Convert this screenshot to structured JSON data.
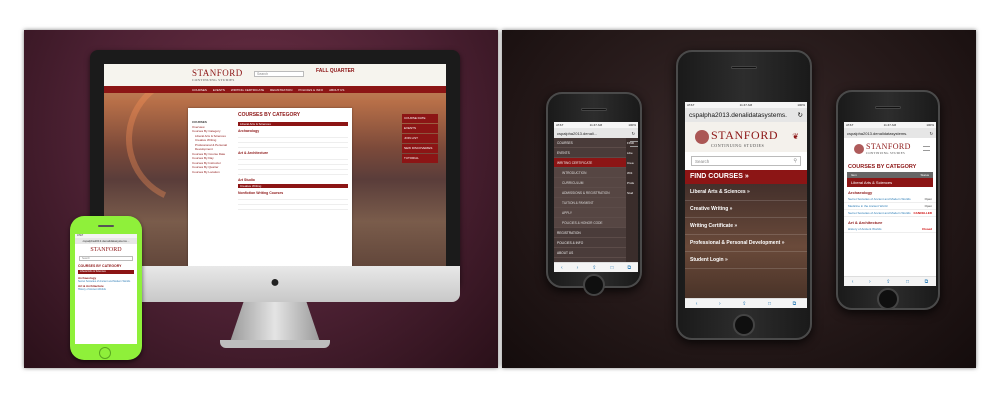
{
  "desktop": {
    "logo": "STANFORD",
    "logo_sub": "CONTINUING STUDIES",
    "search_placeholder": "Search",
    "quarter": "FALL QUARTER",
    "nav": [
      "COURSES",
      "EVENTS",
      "WRITING CERTIFICATE",
      "REGISTRATION",
      "POLICIES & INFO",
      "ABOUT US"
    ],
    "page_title": "COURSES BY CATEGORY",
    "side_title": "COURSES",
    "side_items": [
      "Overview",
      "Courses By Category",
      "Liberal Arts & Sciences",
      "Creative Writing",
      "Professional & Personal Development",
      "Courses By Course Date",
      "Courses By Day",
      "Courses By Instructor",
      "Courses By Quarter",
      "Courses By Location"
    ],
    "bars": [
      "Liberal Arts & Sciences",
      "Creative Writing"
    ],
    "subheads": [
      "Archaeology",
      "Art & Architecture",
      "Art Studio",
      "Nonfiction Writing Courses"
    ],
    "side_buttons": [
      "COURSE DATE",
      "EVENTS",
      "JOIN LIST",
      "NEW DISCOVERIES",
      "TUTORIAL"
    ]
  },
  "green_phone": {
    "status": "AT&T",
    "url": "cspalpha2013.denalidatasystems...",
    "logo": "STANFORD",
    "search_placeholder": "Search",
    "heading": "COURSES BY CATEGORY",
    "red_bar": "Liberal Arts & Sciences",
    "sub1": "Archaeology",
    "line1": "Secret Societies of Ancient and Modern Worlds",
    "sub2": "Art & Architecture",
    "line2": "History of Ancient Worlds"
  },
  "phone_a": {
    "status_left": "AT&T",
    "status_time": "11:47 AM",
    "status_right": "100%",
    "url": "cspalpha2013.denali...",
    "menu": [
      {
        "label": "COURSES",
        "type": "top"
      },
      {
        "label": "EVENTS",
        "type": "top"
      },
      {
        "label": "WRITING CERTIFICATE",
        "type": "active"
      },
      {
        "label": "INTRODUCTION",
        "type": "sub"
      },
      {
        "label": "CURRICULUM",
        "type": "sub"
      },
      {
        "label": "ADMISSIONS & REGISTRATION",
        "type": "sub"
      },
      {
        "label": "TUITION & PAYMENT",
        "type": "sub"
      },
      {
        "label": "APPLY",
        "type": "sub"
      },
      {
        "label": "POLICIES & HONOR CODE",
        "type": "sub"
      },
      {
        "label": "REGISTRATION",
        "type": "top"
      },
      {
        "label": "POLICIES & INFO",
        "type": "top"
      },
      {
        "label": "ABOUT US",
        "type": "top"
      }
    ],
    "peek": [
      "FIND",
      "Libe",
      "Crea",
      "Writ",
      "Profe",
      "Stud"
    ]
  },
  "phone_b": {
    "status_left": "AT&T",
    "status_time": "11:47 AM",
    "status_right": "100%",
    "url": "cspalpha2013.denalidatasystems.",
    "reload": "↻",
    "logo": "STANFORD",
    "logo_sub": "CONTINUING STUDIES",
    "search_placeholder": "Search",
    "find_courses": "FIND COURSES »",
    "items": [
      "Liberal Arts & Sciences »",
      "Creative Writing »",
      "Writing Certificate »",
      "Professional & Personal Development »",
      "Student Login »"
    ]
  },
  "phone_c": {
    "status_left": "AT&T",
    "status_time": "11:47 AM",
    "status_right": "100%",
    "url": "cspalpha2013.denalidatasystems.",
    "logo": "STANFORD",
    "logo_sub": "CONTINUING STUDIES",
    "heading": "COURSES BY CATEGORY",
    "col1": "Item",
    "col2": "Status",
    "red_bar": "Liberal Arts & Sciences",
    "sub1": "Archaeology",
    "rows1": [
      {
        "text": "Secret Societies of Ancient and Modern Worlds",
        "status": "Open"
      },
      {
        "text": "Medicine in the Ancient World",
        "status": "Open"
      },
      {
        "text": "Secret Societies of Ancient and Modern Worlds",
        "status": "CANCELLED"
      }
    ],
    "sub2": "Art & Architecture",
    "rows2": [
      {
        "text": "History of Ancient Worlds",
        "status": "Closed"
      }
    ]
  },
  "colors": {
    "cardinal": "#8c1515",
    "link": "#2a7bb5",
    "green": "#8ff03a"
  }
}
